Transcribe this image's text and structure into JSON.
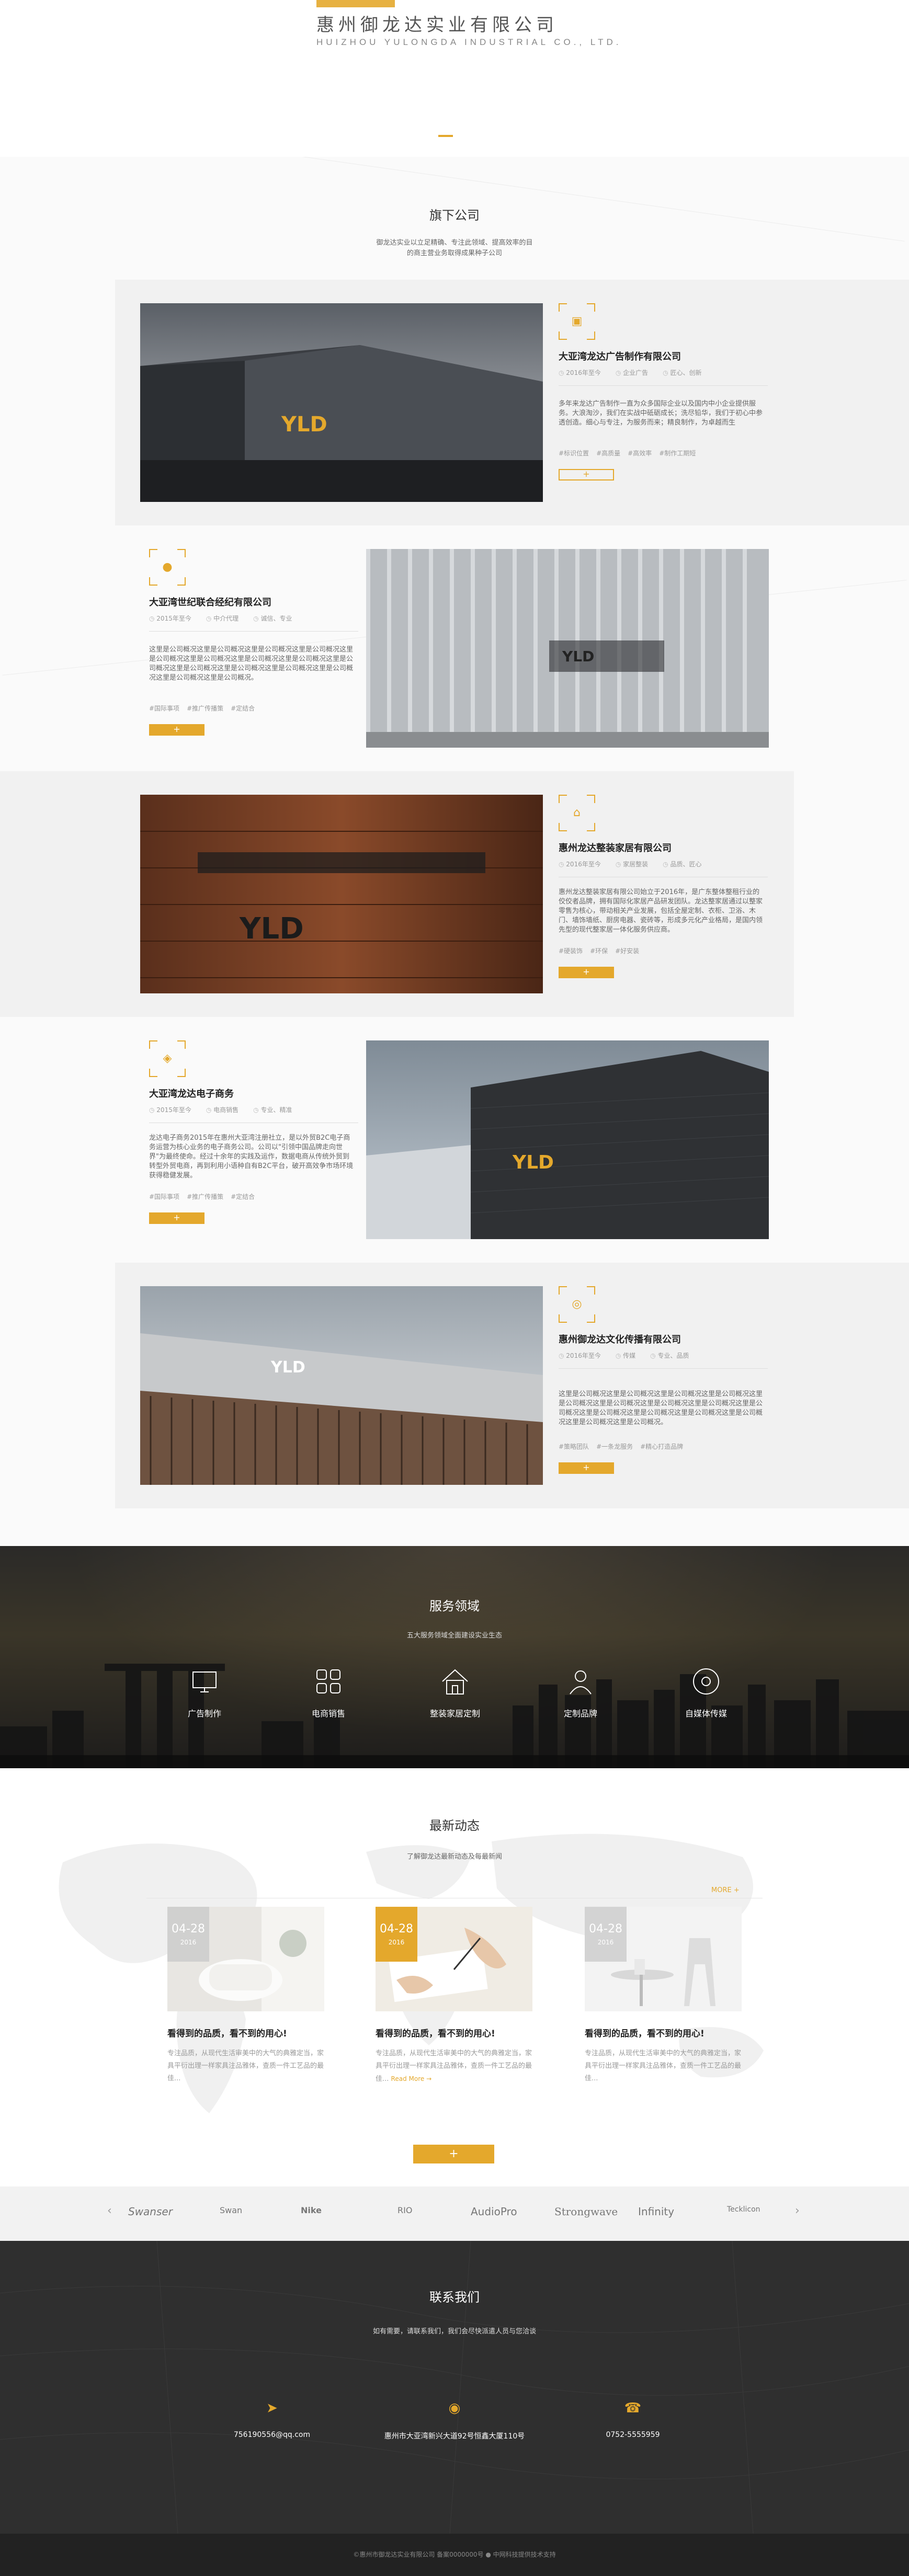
{
  "header": {
    "company_cn": "惠州御龙达实业有限公司",
    "company_en": "HUIZHOU YULONGDA INDUSTRIAL CO., LTD."
  },
  "companies": {
    "title": "旗下公司",
    "subtitle": "御龙达实业以立足精确、专注此领域、提高效率的目的商主营业务取得成果种子公司",
    "items": [
      {
        "name": "大亚湾龙达广告制作有限公司",
        "year": "2016年至今",
        "type": "企业广告",
        "motto": "匠心、创新",
        "desc": "多年来龙达广告制作一直为众多国际企业以及国内中小企业提供服务。大浪淘沙，我们在实战中砥砺成长；洗尽铅华，我们于初心中参透创造。细心与专注，为服务而来；精良制作，为卓越而生",
        "tags": [
          "#标识位置",
          "#高质量",
          "#高效率",
          "#制作工期短"
        ],
        "icon": "image-icon"
      },
      {
        "name": "大亚湾世纪联合经纪有限公司",
        "year": "2015年至今",
        "type": "中介代理",
        "motto": "诚信、专业",
        "desc": "这里是公司概况这里是公司概况这里是公司概况这里是公司概况这里是公司概况这里是公司概况这里是公司概况这里是公司概况这里是公司概况这里是公司概况这里是公司概况这里是公司概况这里是公司概况这里是公司概况这里是公司概况。",
        "tags": [
          "#国际事项",
          "#推广传播策",
          "#定结合"
        ],
        "icon": "user-icon"
      },
      {
        "name": "惠州龙达整装家居有限公司",
        "year": "2016年至今",
        "type": "家居整装",
        "motto": "品质、匠心",
        "desc": "惠州龙达整装家居有限公司始立于2016年，是广东整体整租行业的佼佼者品牌，拥有国际化家居产品研发团队。龙达整家居通过以整家零售为核心，带动相关产业发展，包括全屋定制、衣柜、卫浴、木门、墙饰墙纸、厨房电器、瓷砖等，形成多元化产业格局，是国内领先型的现代整家居一体化服务供应商。",
        "tags": [
          "#硬装饰",
          "#环保",
          "#好安装"
        ],
        "icon": "home-icon"
      },
      {
        "name": "大亚湾龙达电子商务",
        "year": "2015年至今",
        "type": "电商销售",
        "motto": "专业、精准",
        "desc": "龙达电子商务2015年在惠州大亚湾注册社立，是以外贸B2C电子商务运营为核心业务的电子商务公司。公司以\"引领中国品牌走向世界\"为最终使命。经过十余年的实践及运作，数据电商从传统外贸到转型外贸电商，再到利用小语种自有B2C平台，破开高效争市场环境获得稳健发展。",
        "tags": [
          "#国际事项",
          "#推广传播策",
          "#定结合"
        ],
        "icon": "tag-icon"
      },
      {
        "name": "惠州御龙达文化传播有限公司",
        "year": "2016年至今",
        "type": "传媒",
        "motto": "专业、品质",
        "desc": "这里是公司概况这里是公司概况这里是公司概况这里是公司概况这里是公司概况这里是公司概况这里是公司概况这里是公司概况这里是公司概况这里是公司概况这里是公司概况这里是公司概况这里是公司概况这里是公司概况这里是公司概况。",
        "tags": [
          "#策略团队",
          "#一条龙服务",
          "#精心打造品牌"
        ],
        "icon": "ring-icon"
      }
    ]
  },
  "services": {
    "title": "服务领域",
    "subtitle": "五大服务领域全面建设实业生态",
    "items": [
      {
        "label": "广告制作",
        "icon": "monitor-icon"
      },
      {
        "label": "电商销售",
        "icon": "grid-icon"
      },
      {
        "label": "整装家居定制",
        "icon": "house-icon"
      },
      {
        "label": "定制品牌",
        "icon": "person-icon"
      },
      {
        "label": "自媒体传媒",
        "icon": "disc-icon"
      }
    ]
  },
  "news": {
    "title": "最新动态",
    "subtitle": "了解御龙达最新动态及每最新闻",
    "more": "MORE +",
    "items": [
      {
        "day": "04-28",
        "year": "2016",
        "title": "看得到的品质，看不到的用心!",
        "text": "专注品质，从现代生活审美中的大气的典雅定当，家具平衍出理一样家具注品雅体，查质一件工艺品的最佳..."
      },
      {
        "day": "04-28",
        "year": "2016",
        "title": "看得到的品质，看不到的用心!",
        "text": "专注品质，从现代生活审美中的大气的典雅定当，家具平衍出理一样家具注品雅体，查质一件工艺品的最佳...",
        "read_more": "Read More →"
      },
      {
        "day": "04-28",
        "year": "2016",
        "title": "看得到的品质，看不到的用心!",
        "text": "专注品质，从现代生活审美中的大气的典雅定当，家具平衍出理一样家具注品雅体，查质一件工艺品的最佳..."
      }
    ],
    "more_button": "+"
  },
  "partners": {
    "logos": [
      "Swanser",
      "Swan",
      "Nike",
      "RIO",
      "AudioPro",
      "Strongwave",
      "Infinity",
      "Tecklicon"
    ],
    "prev": "‹",
    "next": "›"
  },
  "contact": {
    "title": "联系我们",
    "subtitle": "如有需要，请联系我们，我们会尽快派遣人员与您洽谈",
    "email": "756190556@qq.com",
    "address": "惠州市大亚湾新兴大道92号恒鑫大厦110号",
    "phone": "0752-5555959"
  },
  "footer": {
    "text": "©惠州市御龙达实业有限公司 备案0000000号 ● 中网科技提供技术支持"
  },
  "colors": {
    "accent": "#e4a82c",
    "dark": "#2f2f2f"
  }
}
